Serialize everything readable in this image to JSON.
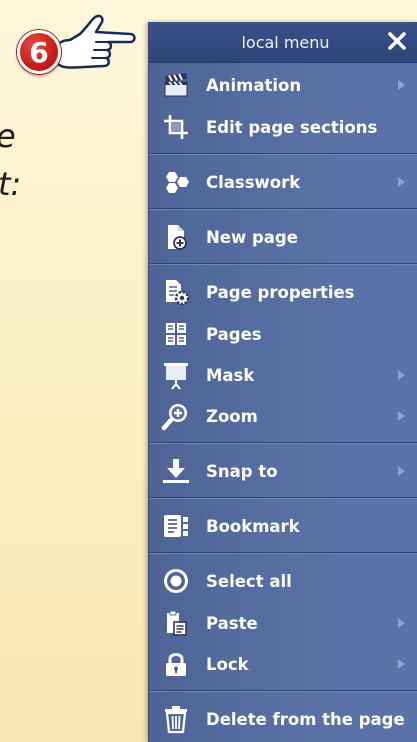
{
  "background": {
    "line1": "e",
    "line2": "t:"
  },
  "callout": {
    "number": "6",
    "pointer_icon": "pointing-hand-icon"
  },
  "menu": {
    "title": "local menu",
    "close_icon": "close-icon",
    "items": [
      {
        "label": "Animation",
        "icon": "clapperboard-icon",
        "has_submenu": true
      },
      {
        "label": "Edit page sections",
        "icon": "crop-frame-icon",
        "has_submenu": false
      },
      {
        "label": "Classwork",
        "icon": "molecule-icon",
        "has_submenu": true
      },
      {
        "label": "New page",
        "icon": "new-page-icon",
        "has_submenu": false
      },
      {
        "label": "Page properties",
        "icon": "page-settings-icon",
        "has_submenu": false
      },
      {
        "label": "Pages",
        "icon": "pages-grid-icon",
        "has_submenu": false
      },
      {
        "label": "Mask",
        "icon": "projector-screen-icon",
        "has_submenu": true
      },
      {
        "label": "Zoom",
        "icon": "zoom-in-icon",
        "has_submenu": true
      },
      {
        "label": "Snap to",
        "icon": "snap-arrow-icon",
        "has_submenu": true
      },
      {
        "label": "Bookmark",
        "icon": "bookmark-icon",
        "has_submenu": false
      },
      {
        "label": "Select all",
        "icon": "select-all-icon",
        "has_submenu": false
      },
      {
        "label": "Paste",
        "icon": "clipboard-icon",
        "has_submenu": true
      },
      {
        "label": "Lock",
        "icon": "lock-icon",
        "has_submenu": true
      },
      {
        "label": "Delete from the page",
        "icon": "trash-icon",
        "has_submenu": false
      }
    ]
  },
  "colors": {
    "menu_bg": "#5a71a6",
    "header_bg": "#2e4478",
    "badge_red": "#c51d18",
    "page_bg": "#fbf0c6"
  }
}
